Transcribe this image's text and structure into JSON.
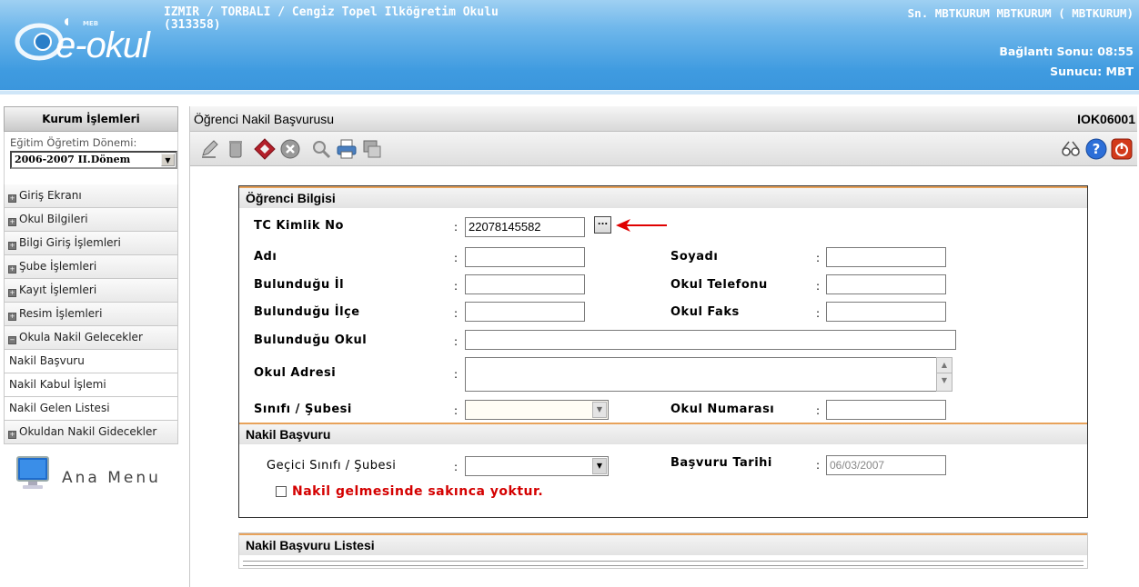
{
  "header": {
    "logo_meb": "MEB",
    "logo_text": "e-okul",
    "school_line1": "IZMIR / TORBALI / Cengiz Topel Ilköğretim Okulu",
    "school_line2": "(313358)",
    "user": "Sn. MBTKURUM MBTKURUM ( MBTKURUM)",
    "connection": "Bağlantı Sonu: 08:55",
    "server": "Sunucu: MBT"
  },
  "sidebar": {
    "title": "Kurum İşlemleri",
    "term_label": "Eğitim Öğretim Dönemi:",
    "term_value": "2006-2007 II.Dönem",
    "items": [
      {
        "label": "Giriş Ekranı"
      },
      {
        "label": "Okul Bilgileri"
      },
      {
        "label": "Bilgi Giriş İşlemleri"
      },
      {
        "label": "Şube İşlemleri"
      },
      {
        "label": "Kayıt İşlemleri"
      },
      {
        "label": "Resim İşlemleri"
      },
      {
        "label": "Okula Nakil Gelecekler"
      }
    ],
    "subitems": [
      {
        "label": "Nakil Başvuru"
      },
      {
        "label": "Nakil Kabul İşlemi"
      },
      {
        "label": "Nakil Gelen Listesi"
      }
    ],
    "last_item": "Okuldan Nakil Gidecekler",
    "ana_menu": "Ana Menu"
  },
  "page": {
    "title": "Öğrenci Nakil Başvurusu",
    "code": "IOK06001"
  },
  "form": {
    "section1": "Öğrenci Bilgisi",
    "tc_label": "TC Kimlik No",
    "tc_value": "22078145582",
    "lookup_button": "...",
    "name_label": "Adı",
    "surname_label": "Soyadı",
    "city_label": "Bulunduğu İl",
    "school_phone_label": "Okul Telefonu",
    "district_label": "Bulunduğu İlçe",
    "school_fax_label": "Okul Faks",
    "school_label": "Bulunduğu Okul",
    "address_label": "Okul Adresi",
    "class_label": "Sınıfı / Şubesi",
    "school_no_label": "Okul Numarası",
    "colon": ":",
    "section2": "Nakil Başvuru",
    "temp_class_label": "Geçici Sınıfı / Şubesi",
    "apply_date_label": "Başvuru Tarihi",
    "apply_date_value": "06/03/2007",
    "no_objection_label": "Nakil gelmesinde sakınca yoktur."
  },
  "list": {
    "title": "Nakil Başvuru Listesi"
  },
  "colors": {
    "header_blue": "#3f9be0",
    "section_accent": "#e8a25a",
    "warning_red": "#d40000",
    "arrow_red": "#e00000"
  }
}
